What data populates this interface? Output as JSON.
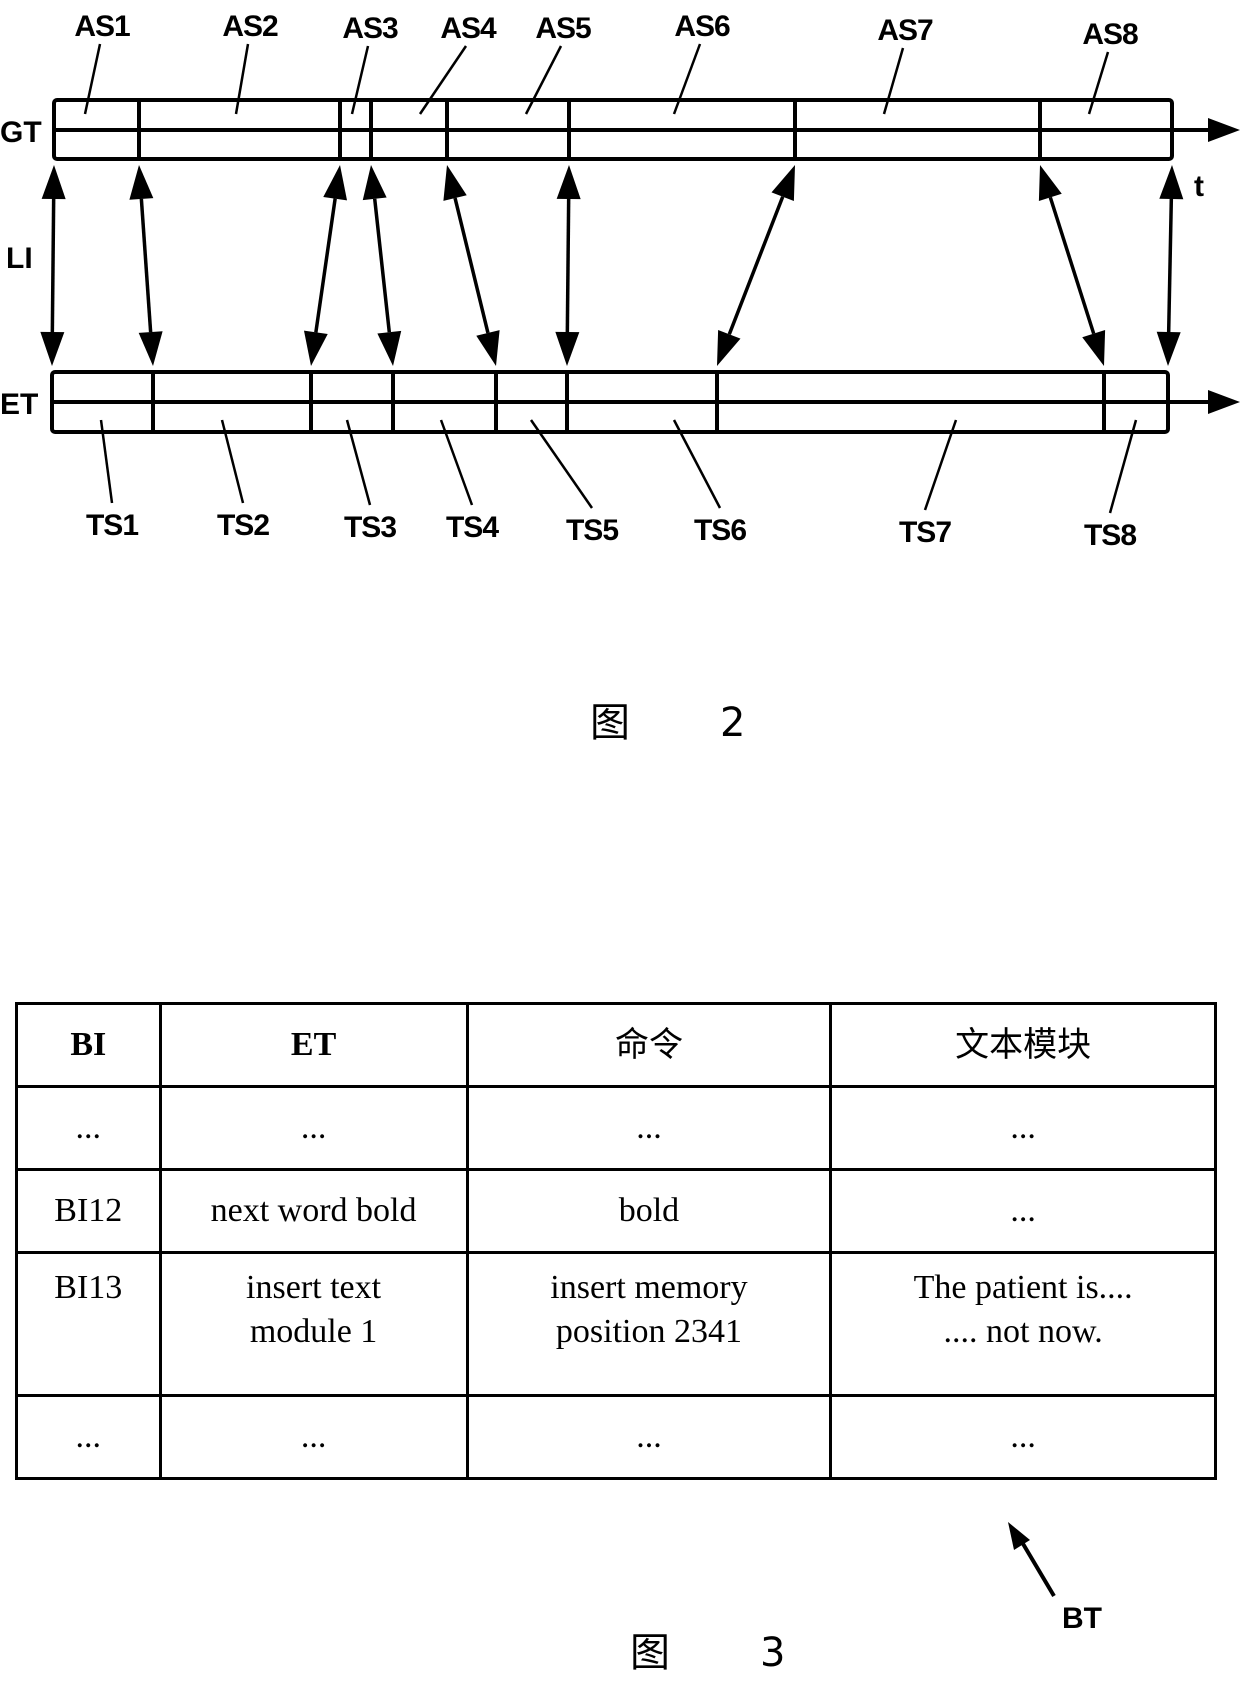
{
  "figure2": {
    "caption_char": "图",
    "caption_num": "2",
    "track_gt_label": "GT",
    "track_et_label": "ET",
    "link_label": "LI",
    "time_label": "t",
    "gt_segments": [
      "AS1",
      "AS2",
      "AS3",
      "AS4",
      "AS5",
      "AS6",
      "AS7",
      "AS8"
    ],
    "et_segments": [
      "TS1",
      "TS2",
      "TS3",
      "TS4",
      "TS5",
      "TS6",
      "TS7",
      "TS8"
    ],
    "links": [
      {
        "from": "AS1 start",
        "to": "TS1 start"
      },
      {
        "from": "AS2 start",
        "to": "TS2 start"
      },
      {
        "from": "AS3 start",
        "to": "TS3 start"
      },
      {
        "from": "AS4 start",
        "to": "TS4 start"
      },
      {
        "from": "AS5 start",
        "to": "TS5 start"
      },
      {
        "from": "AS6 start",
        "to": "TS6 start"
      },
      {
        "from": "AS7 start",
        "to": "TS7 start"
      },
      {
        "from": "AS8 start",
        "to": "TS8 start"
      },
      {
        "from": "AS8 end",
        "to": "TS8 end"
      }
    ]
  },
  "figure3": {
    "caption_char": "图",
    "caption_num": "3",
    "reference_label": "BT",
    "table": {
      "headers": [
        "BI",
        "ET",
        "命令",
        "文本模块"
      ],
      "rows": [
        [
          "...",
          "...",
          "...",
          "..."
        ],
        [
          "BI12",
          "next word bold",
          "bold",
          "..."
        ],
        [
          "BI13",
          "insert text\nmodule 1",
          "insert memory\nposition 2341",
          "The patient is....\n.... not now."
        ],
        [
          "...",
          "...",
          "...",
          "..."
        ]
      ]
    }
  }
}
